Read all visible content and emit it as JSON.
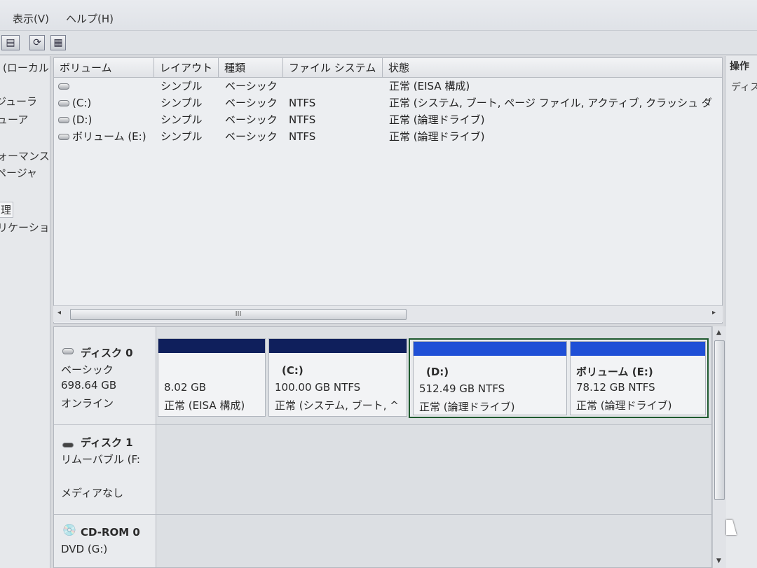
{
  "menu": {
    "view": "表示(V)",
    "help": "ヘルプ(H)"
  },
  "toolbar": {
    "icons": [
      "view-icon",
      "refresh-icon",
      "properties-icon"
    ]
  },
  "tree": {
    "items": [
      "(ローカル",
      "ジューラ",
      "ューア",
      "ォーマンス",
      "ページャ",
      "理",
      "リケーショ"
    ]
  },
  "volume_list": {
    "columns": [
      "ボリューム",
      "レイアウト",
      "種類",
      "ファイル システム",
      "状態"
    ],
    "rows": [
      {
        "volume": "",
        "layout": "シンプル",
        "type": "ベーシック",
        "fs": "",
        "status": "正常 (EISA 構成)"
      },
      {
        "volume": "(C:)",
        "layout": "シンプル",
        "type": "ベーシック",
        "fs": "NTFS",
        "status": "正常 (システム, ブート, ページ ファイル, アクティブ, クラッシュ ダ"
      },
      {
        "volume": "(D:)",
        "layout": "シンプル",
        "type": "ベーシック",
        "fs": "NTFS",
        "status": "正常 (論理ドライブ)"
      },
      {
        "volume": "ボリューム (E:)",
        "layout": "シンプル",
        "type": "ベーシック",
        "fs": "NTFS",
        "status": "正常 (論理ドライブ)"
      }
    ],
    "scroll_grip": "III"
  },
  "actions": {
    "header": "操作",
    "item": "ディス"
  },
  "disks": [
    {
      "name": "ディスク 0",
      "type": "ベーシック",
      "size": "698.64 GB",
      "state": "オンライン",
      "partitions": [
        {
          "label": "",
          "size": "8.02 GB",
          "status": "正常 (EISA 構成)",
          "bar_color": "#0f1f5c"
        },
        {
          "label": "(C:)",
          "size": "100.00 GB NTFS",
          "status": "正常 (システム, ブート, ^",
          "bar_color": "#0f1f5c"
        },
        {
          "label": "(D:)",
          "size": "512.49 GB NTFS",
          "status": "正常 (論理ドライブ)",
          "bar_color": "#1f4fd6"
        },
        {
          "label": "ボリューム (E:)",
          "size": "78.12 GB NTFS",
          "status": "正常 (論理ドライブ)",
          "bar_color": "#1f4fd6"
        }
      ]
    },
    {
      "name": "ディスク 1",
      "type": "リムーバブル (F:",
      "state": "メディアなし"
    },
    {
      "name": "CD-ROM 0",
      "type": "DVD (G:)"
    }
  ],
  "colors": {
    "primary_bar": "#0f1f5c",
    "logical_bar": "#1f4fd6",
    "selection_border": "#1f5a2f"
  }
}
